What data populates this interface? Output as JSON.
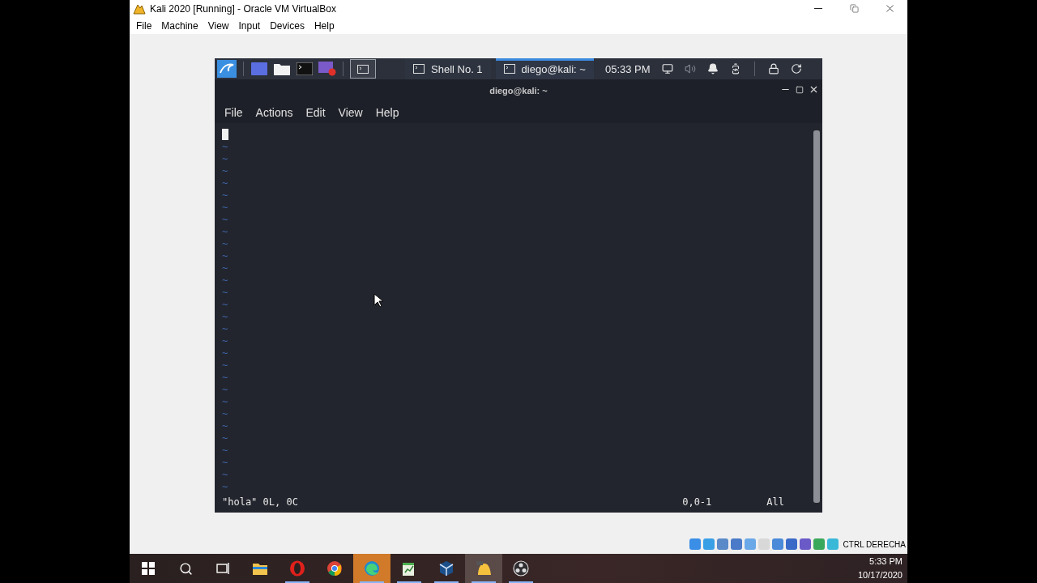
{
  "window": {
    "title": "Kali 2020 [Running] - Oracle VM VirtualBox"
  },
  "menu": [
    "File",
    "Machine",
    "View",
    "Input",
    "Devices",
    "Help"
  ],
  "kali_panel": {
    "tasks": [
      {
        "label": "Shell No. 1",
        "selected": false
      },
      {
        "label": "diego@kali: ~",
        "selected": true
      }
    ],
    "clock": "05:33 PM"
  },
  "terminal": {
    "title": "diego@kali: ~",
    "menu": [
      "File",
      "Actions",
      "Edit",
      "View",
      "Help"
    ],
    "lines": [
      "~",
      "~",
      "~",
      "~",
      "~",
      "~",
      "~",
      "~",
      "~",
      "~",
      "~",
      "~",
      "~",
      "~",
      "~",
      "~",
      "~",
      "~",
      "~",
      "~",
      "~",
      "~",
      "~",
      "~",
      "~",
      "~",
      "~",
      "~",
      "~"
    ],
    "status": {
      "message": "\"hola\" 0L, 0C",
      "position": "0,0-1",
      "scroll": "All"
    }
  },
  "host_status": {
    "host_key": "CTRL DERECHA"
  },
  "taskbar": {
    "apps": [
      {
        "kind": "explorer",
        "running": false,
        "selected": false,
        "attention": false
      },
      {
        "kind": "opera",
        "running": true,
        "selected": false,
        "attention": false
      },
      {
        "kind": "chrome",
        "running": false,
        "selected": false,
        "attention": false
      },
      {
        "kind": "edge",
        "running": true,
        "selected": false,
        "attention": true
      },
      {
        "kind": "notepad",
        "running": true,
        "selected": false,
        "attention": false
      },
      {
        "kind": "virtualbox",
        "running": true,
        "selected": false,
        "attention": false
      },
      {
        "kind": "kali",
        "running": true,
        "selected": true,
        "attention": false
      },
      {
        "kind": "obs",
        "running": true,
        "selected": false,
        "attention": false
      }
    ],
    "time": "5:33 PM",
    "date": "10/17/2020"
  }
}
